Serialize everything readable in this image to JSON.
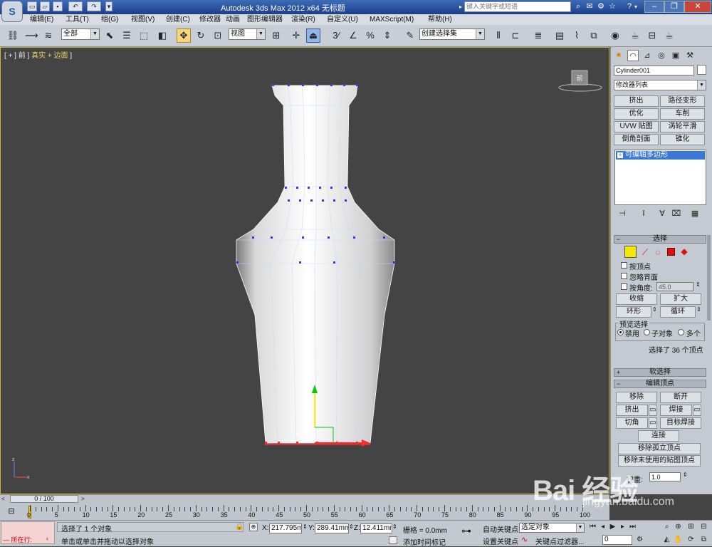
{
  "title_bar": {
    "title": "Autodesk 3ds Max  2012 x64    无标题",
    "search_placeholder": "键入关键字或短语"
  },
  "menu": [
    "编辑(E)",
    "工具(T)",
    "组(G)",
    "视图(V)",
    "创建(C)",
    "修改器",
    "动画",
    "图形编辑器",
    "渲染(R)",
    "自定义(U)",
    "MAXScript(M)",
    "帮助(H)"
  ],
  "toolbar": {
    "filter_select": "全部",
    "refcoord_select": "视图",
    "named_selection": "创建选择集"
  },
  "viewport": {
    "label_prefix": "[ + ] 前 ]",
    "label_shading": "真实 + 边面",
    "label_suffix": "]",
    "viewcube_text": "前"
  },
  "command_panel": {
    "object_name": "Cylinder001",
    "modifier_list": "修改器列表",
    "modifier_buttons": [
      "挤出",
      "路径变形",
      "优化",
      "车削",
      "UVW 贴图",
      "涡轮平滑",
      "倒角剖面",
      "锥化"
    ],
    "stack_item": "可编辑多边形",
    "selection_rollout": {
      "title": "选择",
      "by_vertex": "按顶点",
      "ignore_backfacing": "忽略背面",
      "by_angle": "按角度:",
      "angle_value": "45.0",
      "shrink": "收缩",
      "grow": "扩大",
      "ring": "环形",
      "loop": "循环",
      "preview_group": "预览选择",
      "preview_off": "禁用",
      "preview_subobj": "子对象",
      "preview_multi": "多个",
      "selection_info": "选择了 36 个顶点"
    },
    "soft_selection_title": "软选择",
    "edit_vertices": {
      "title": "编辑顶点",
      "remove": "移除",
      "break": "断开",
      "extrude": "挤出",
      "weld": "焊接",
      "chamfer": "切角",
      "target_weld": "目标焊接",
      "connect": "连接",
      "remove_isolated": "移除孤立顶点",
      "remove_unused_map": "移除未使用的贴图顶点",
      "weight_label": "权重:",
      "weight_value": "1.0"
    }
  },
  "timeline": {
    "frame_counter": "0 / 100",
    "ticks": [
      "0",
      "5",
      "10",
      "15",
      "20",
      "25",
      "30",
      "35",
      "40",
      "45",
      "50",
      "55",
      "60",
      "65",
      "70",
      "75",
      "80",
      "85",
      "90",
      "95",
      "100"
    ]
  },
  "status_bar": {
    "script_label": "所在行:",
    "selection_msg": "选择了 1 个对象",
    "prompt_msg": "单击或单击并拖动以选择对象",
    "x_label": "X:",
    "x_value": "217.795mm",
    "y_label": "Y:",
    "y_value": "289.41mm",
    "z_label": "Z:",
    "z_value": "12.411mm",
    "grid": "栅格 = 0.0mm",
    "add_time_tag": "添加时间标记",
    "auto_key": "自动关键点",
    "set_key": "设置关键点",
    "selected_object": "选定对象",
    "key_filters": "关键点过滤器...",
    "frame_value": "0"
  },
  "watermark": {
    "text": "Bai 经验",
    "url": "jingyan.baidu.com"
  },
  "colors": {
    "title_bar": "#2a56a2",
    "viewport_bg": "#444444",
    "active_border": "#d1b23c",
    "selected_blue": "#3a78d4",
    "vertex_blue": "#3636ff"
  }
}
